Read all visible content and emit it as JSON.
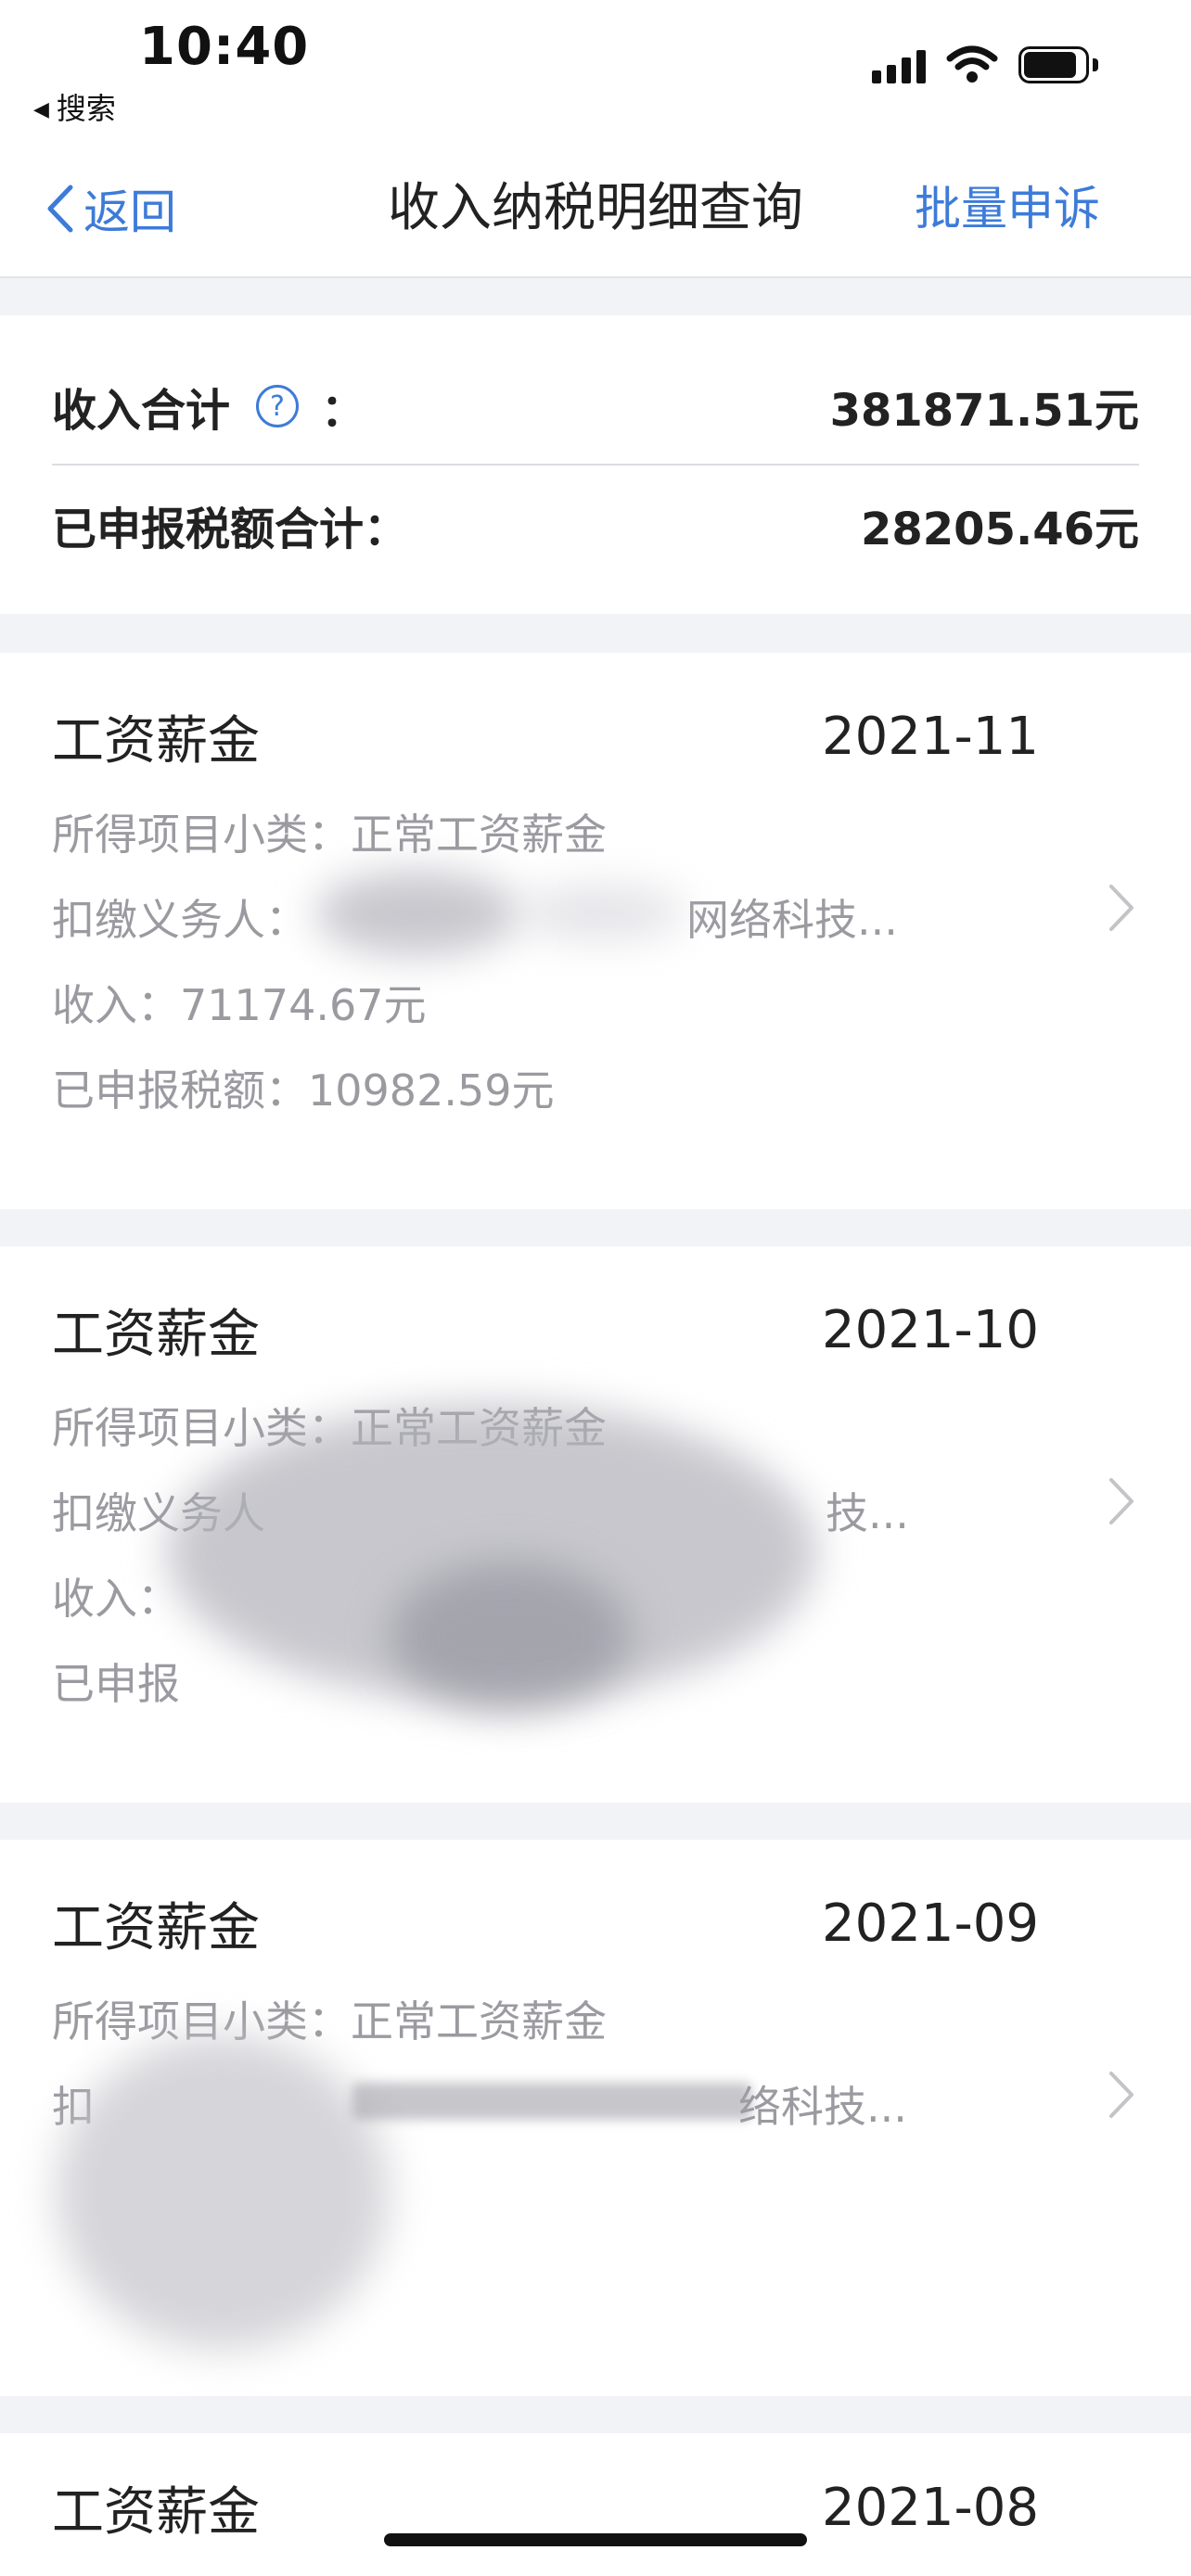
{
  "status_bar": {
    "time": "10:40",
    "back_app": "搜索"
  },
  "nav": {
    "back_label": "返回",
    "title": "收入纳税明细查询",
    "action": "批量申诉"
  },
  "summary": {
    "income_label": "收入合计",
    "income_colon": "：",
    "income_value": "381871.51元",
    "tax_label": "已申报税额合计：",
    "tax_value": "28205.46元"
  },
  "records": [
    {
      "type": "工资薪金",
      "period": "2021-11",
      "subcategory": "所得项目小类：正常工资薪金",
      "withholder": "扣缴义务人：",
      "withholder_tail": "网络科技...",
      "income": "收入：71174.67元",
      "tax": "已申报税额：10982.59元"
    },
    {
      "type": "工资薪金",
      "period": "2021-10",
      "subcategory": "所得项目小类：正常工资薪金",
      "withholder": "扣缴义务人",
      "withholder_tail": "技...",
      "income": "收入：",
      "tax": "已申报"
    },
    {
      "type": "工资薪金",
      "period": "2021-09",
      "subcategory": "所得项目小类：正常工资薪金",
      "withholder": "扣",
      "withholder_tail": "络科技...",
      "income": "",
      "tax": ""
    },
    {
      "type": "工资薪金",
      "period": "2021-08"
    }
  ],
  "colors": {
    "accent": "#3d7bd9",
    "background": "#f2f3f7",
    "muted_text": "#9a9aa0"
  },
  "icons": [
    "back-chevron-icon",
    "help-icon",
    "chevron-right-icon",
    "signal-icon",
    "wifi-icon",
    "battery-icon"
  ]
}
